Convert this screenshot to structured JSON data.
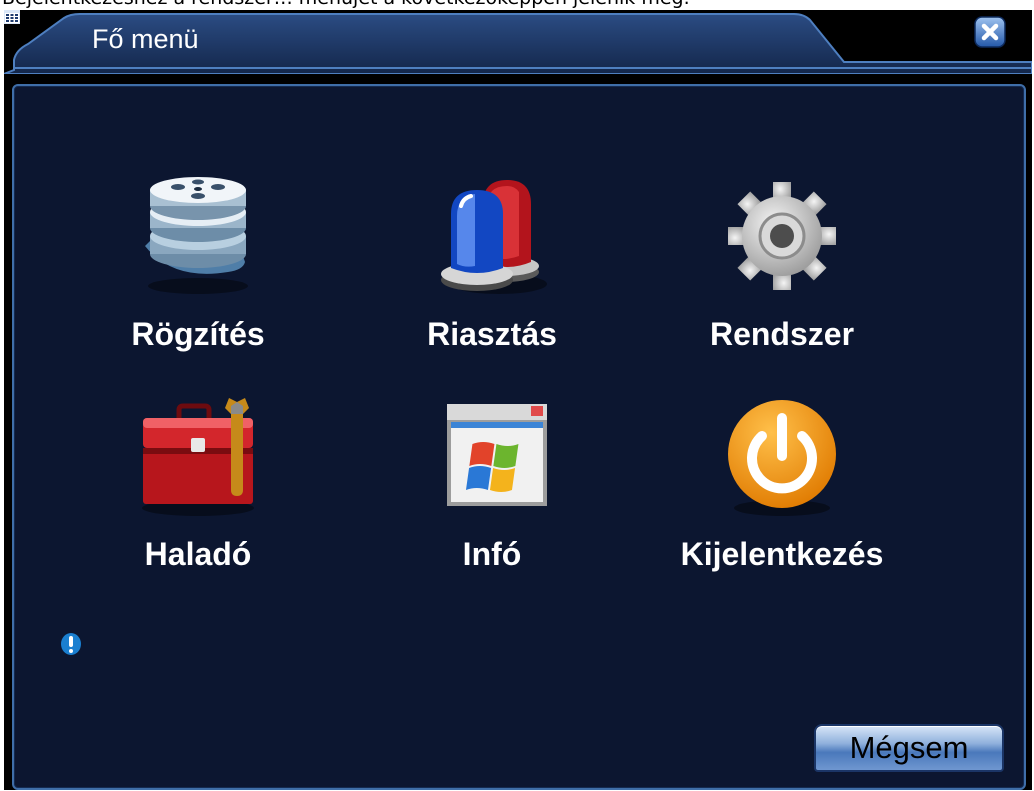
{
  "page_caption": "Bejelentkezéshez a rendszer… menüjét a következőképpen jelenik meg.",
  "window": {
    "title": "Fő menü",
    "title_icon": "grid-menu-icon",
    "close_icon": "close-icon"
  },
  "menu": {
    "items": [
      {
        "label": "Rögzítés",
        "icon": "film-reel-icon"
      },
      {
        "label": "Riasztás",
        "icon": "alarm-siren-icon"
      },
      {
        "label": "Rendszer",
        "icon": "gear-icon"
      },
      {
        "label": "Haladó",
        "icon": "toolbox-icon"
      },
      {
        "label": "Infó",
        "icon": "window-logo-icon"
      },
      {
        "label": "Kijelentkezés",
        "icon": "power-icon"
      }
    ]
  },
  "footer": {
    "info_icon": "info-icon",
    "cancel_label": "Mégsem"
  },
  "colors": {
    "panel_background": "#0c1630",
    "panel_border": "#3f6ea8",
    "title_bar": "#1a2f57"
  }
}
